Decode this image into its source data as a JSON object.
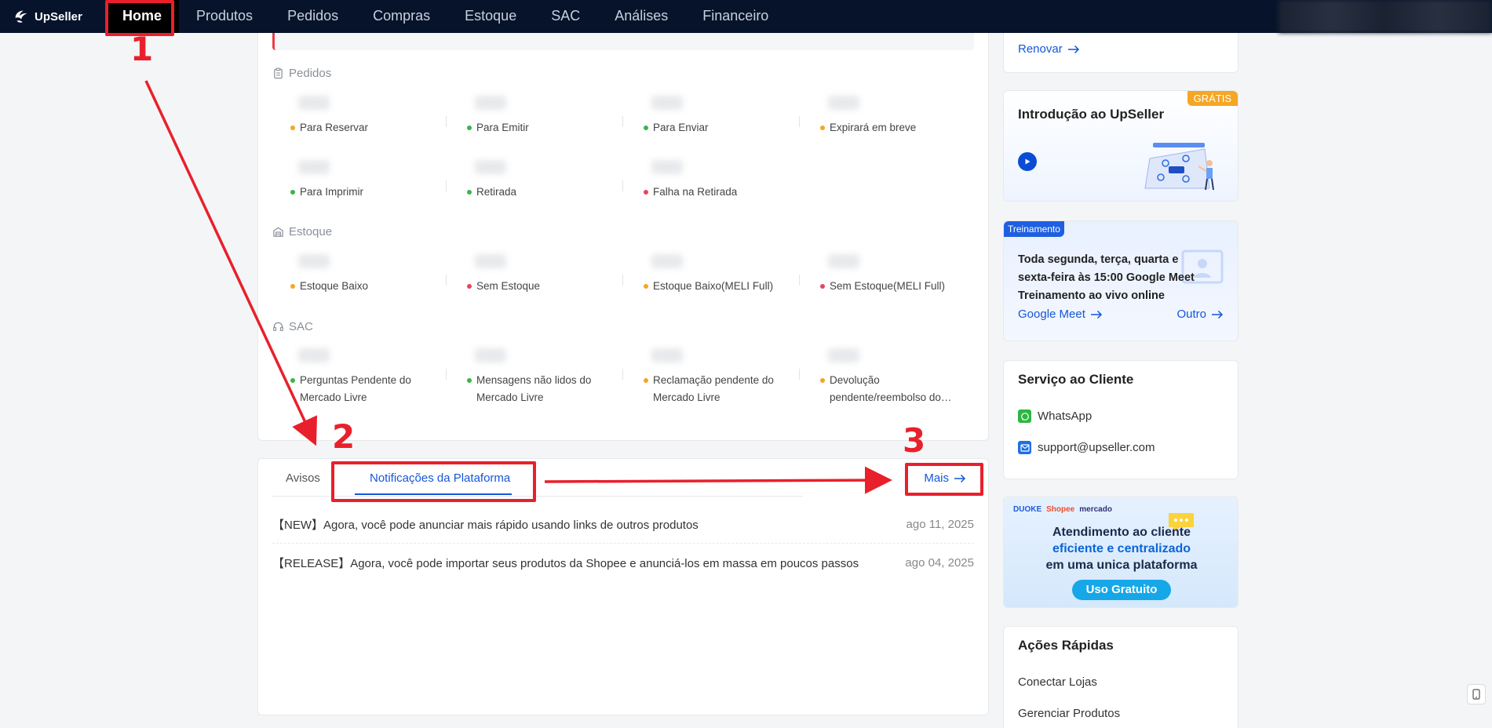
{
  "nav": {
    "brand": "UpSeller",
    "items": [
      {
        "label": "Home",
        "active": true
      },
      {
        "label": "Produtos"
      },
      {
        "label": "Pedidos"
      },
      {
        "label": "Compras"
      },
      {
        "label": "Estoque"
      },
      {
        "label": "SAC"
      },
      {
        "label": "Análises"
      },
      {
        "label": "Financeiro"
      }
    ]
  },
  "sections": {
    "pedidos": {
      "title": "Pedidos",
      "items": [
        "Para Reservar",
        "Para Emitir",
        "Para Enviar",
        "Expirará em breve",
        "Para Imprimir",
        "Retirada",
        "Falha na Retirada"
      ]
    },
    "estoque": {
      "title": "Estoque",
      "items": [
        "Estoque Baixo",
        "Sem Estoque",
        "Estoque Baixo(MELI Full)",
        "Sem Estoque(MELI Full)"
      ]
    },
    "sac": {
      "title": "SAC",
      "items": [
        [
          "Perguntas Pendente do",
          "Mercado Livre"
        ],
        [
          "Mensagens não lidos do",
          "Mercado Livre"
        ],
        [
          "Reclamação pendente do",
          "Mercado Livre"
        ],
        [
          "Devolução",
          "pendente/reembolso do…"
        ]
      ]
    }
  },
  "colors": {
    "orange": "#f5a623",
    "green": "#3bb44a",
    "red": "#e8455a",
    "blue": "#1557d9",
    "annotation": "#e8202b"
  },
  "notices": {
    "tabs": [
      "Avisos",
      "Notificações da Plataforma"
    ],
    "more": "Mais",
    "items": [
      {
        "title": "【NEW】Agora, você pode anunciar mais rápido usando links de outros produtos",
        "date": "ago 11, 2025"
      },
      {
        "title": "【RELEASE】Agora, você pode importar seus produtos da Shopee e anunciá-los em massa em poucos passos",
        "date": "ago 04, 2025"
      }
    ]
  },
  "right": {
    "renew": "Renovar",
    "intro": {
      "badge": "GRÁTIS",
      "title": "Introdução ao UpSeller"
    },
    "training": {
      "badge": "Treinamento",
      "lines": [
        "Toda segunda, terça, quarta e",
        "sexta-feira às 15:00 Google Meet",
        "Treinamento ao vivo online"
      ],
      "link1": "Google Meet",
      "link2": "Outro"
    },
    "service": {
      "title": "Serviço ao Cliente",
      "whatsapp": "WhatsApp",
      "email": "support@upseller.com"
    },
    "promo": {
      "brands": [
        "DUOKE",
        "Shopee",
        "mercado"
      ],
      "line1": "Atendimento ao cliente",
      "line2": "eficiente e centralizado",
      "line3": "em uma unica plataforma",
      "button": "Uso Gratuito"
    },
    "quick": {
      "title": "Ações Rápidas",
      "items": [
        "Conectar Lojas",
        "Gerenciar Produtos"
      ]
    }
  },
  "annotations": [
    "1",
    "2",
    "3"
  ]
}
